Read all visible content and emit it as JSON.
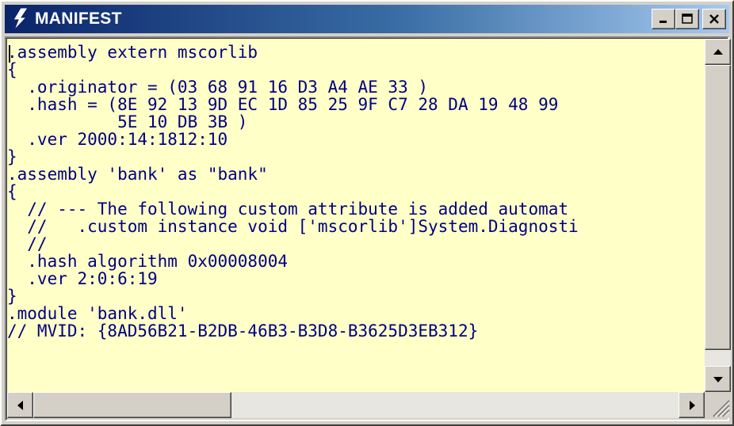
{
  "window": {
    "title": "MANIFEST",
    "title_icon": "lightning-bolt-icon",
    "buttons": {
      "minimize": "minimize-icon",
      "maximize": "maximize-icon",
      "close": "close-icon"
    },
    "accent_color": "#0a246a"
  },
  "editor": {
    "background": "#ffffc8",
    "text_color": "#000080",
    "lines": [
      ".assembly extern mscorlib",
      "{",
      "  .originator = (03 68 91 16 D3 A4 AE 33 )",
      "  .hash = (8E 92 13 9D EC 1D 85 25 9F C7 28 DA 19 48 99",
      "           5E 10 DB 3B )",
      "  .ver 2000:14:1812:10",
      "}",
      ".assembly 'bank' as \"bank\"",
      "{",
      "  // --- The following custom attribute is added automat",
      "  //   .custom instance void ['mscorlib']System.Diagnosti",
      "  //",
      "  .hash algorithm 0x00008004",
      "  .ver 2:0:6:19",
      "}",
      ".module 'bank.dll'",
      "// MVID: {8AD56B21-B2DB-46B3-B3D8-B3625D3EB312}"
    ]
  },
  "scrollbars": {
    "vertical": {
      "up": "scroll-up-arrow-icon",
      "down": "scroll-down-arrow-icon",
      "position": 0.0
    },
    "horizontal": {
      "left": "scroll-left-arrow-icon",
      "right": "scroll-right-arrow-icon",
      "position": 0.0
    },
    "grip": "size-grip-icon"
  }
}
